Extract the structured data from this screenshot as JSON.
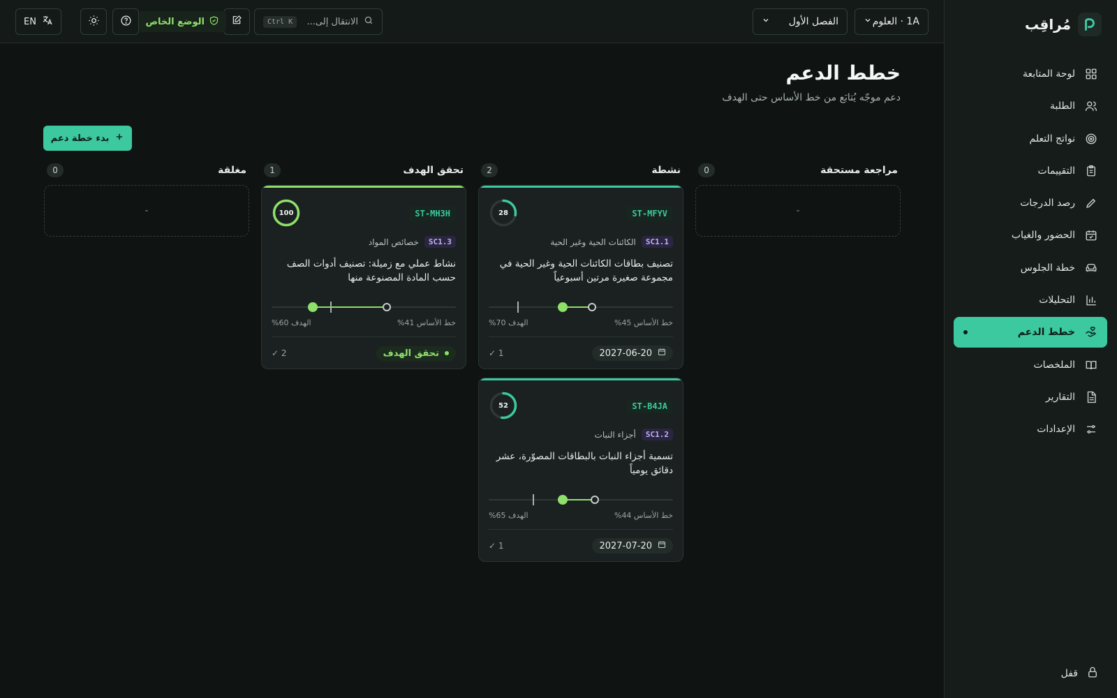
{
  "app": {
    "name": "مُراقِب"
  },
  "sidebar": {
    "items": [
      {
        "label": "لوحة المتابعة",
        "icon": "grid-icon"
      },
      {
        "label": "الطلبة",
        "icon": "users-icon"
      },
      {
        "label": "نواتج التعلم",
        "icon": "target-icon"
      },
      {
        "label": "التقييمات",
        "icon": "clipboard-icon"
      },
      {
        "label": "رصد الدرجات",
        "icon": "pencil-icon"
      },
      {
        "label": "الحضور والغياب",
        "icon": "calendar-check-icon"
      },
      {
        "label": "خطة الجلوس",
        "icon": "sofa-icon"
      },
      {
        "label": "التحليلات",
        "icon": "bar-chart-icon"
      },
      {
        "label": "خطط الدعم",
        "icon": "hand-heart-icon",
        "active": true
      },
      {
        "label": "الملخصات",
        "icon": "book-icon"
      },
      {
        "label": "التقارير",
        "icon": "file-text-icon"
      },
      {
        "label": "الإعدادات",
        "icon": "sliders-icon"
      }
    ],
    "lock_label": "قفل"
  },
  "topbar": {
    "class_select": "1A · العلوم",
    "term_select": "الفصل الأول",
    "search_placeholder": "الانتقال إلى...",
    "search_shortcut": "Ctrl K",
    "private_mode": "الوضع الخاص",
    "lang": "EN"
  },
  "page": {
    "title": "خطط الدعم",
    "subtitle": "دعم موجّه يُتابَع من خط الأساس حتى الهدف",
    "add_button": "بدء خطة دعم"
  },
  "columns": [
    {
      "title": "مراجعة مستحقة",
      "count": "0",
      "empty": "-"
    },
    {
      "title": "نشطة",
      "count": "2"
    },
    {
      "title": "تحقق الهدف",
      "count": "1"
    },
    {
      "title": "مغلقة",
      "count": "0",
      "empty": "-"
    }
  ],
  "cards": [
    {
      "student": "ST-MFYV",
      "progress": 28,
      "outcome_code": "SC1.1",
      "outcome_name": "الكائنات الحية وغير الحية",
      "description": "تصنيف بطاقات الكائنات الحية وغير الحية في مجموعة صغيرة مرتين أسبوعياً",
      "baseline": 45,
      "target": 70,
      "current": 55,
      "baseline_label": "خط الأساس 45%",
      "target_label": "الهدف 70%",
      "date": "2027-06-20",
      "checks": "✓ 1"
    },
    {
      "student": "ST-B4JA",
      "progress": 52,
      "outcome_code": "SC1.2",
      "outcome_name": "أجزاء النبات",
      "description": "تسمية أجزاء النبات بالبطاقات المصوّرة، عشر دقائق يومياً",
      "baseline": 44,
      "target": 65,
      "current": 55,
      "baseline_label": "خط الأساس 44%",
      "target_label": "الهدف 65%",
      "date": "2027-07-20",
      "checks": "✓ 1"
    },
    {
      "student": "ST-MH3H",
      "progress": 100,
      "outcome_code": "SC1.3",
      "outcome_name": "خصائص المواد",
      "description": "نشاط عملي مع زميلة: تصنيف أدوات الصف حسب المادة المصنوعة منها",
      "baseline": 41,
      "target": 60,
      "current": 66,
      "baseline_label": "خط الأساس 41%",
      "target_label": "الهدف 60%",
      "status": "تحقق الهدف",
      "checks": "✓ 2"
    }
  ],
  "colors": {
    "accent": "#3cc9a0",
    "achieved": "#8ee06a",
    "outcome": "#c2b4f3"
  }
}
